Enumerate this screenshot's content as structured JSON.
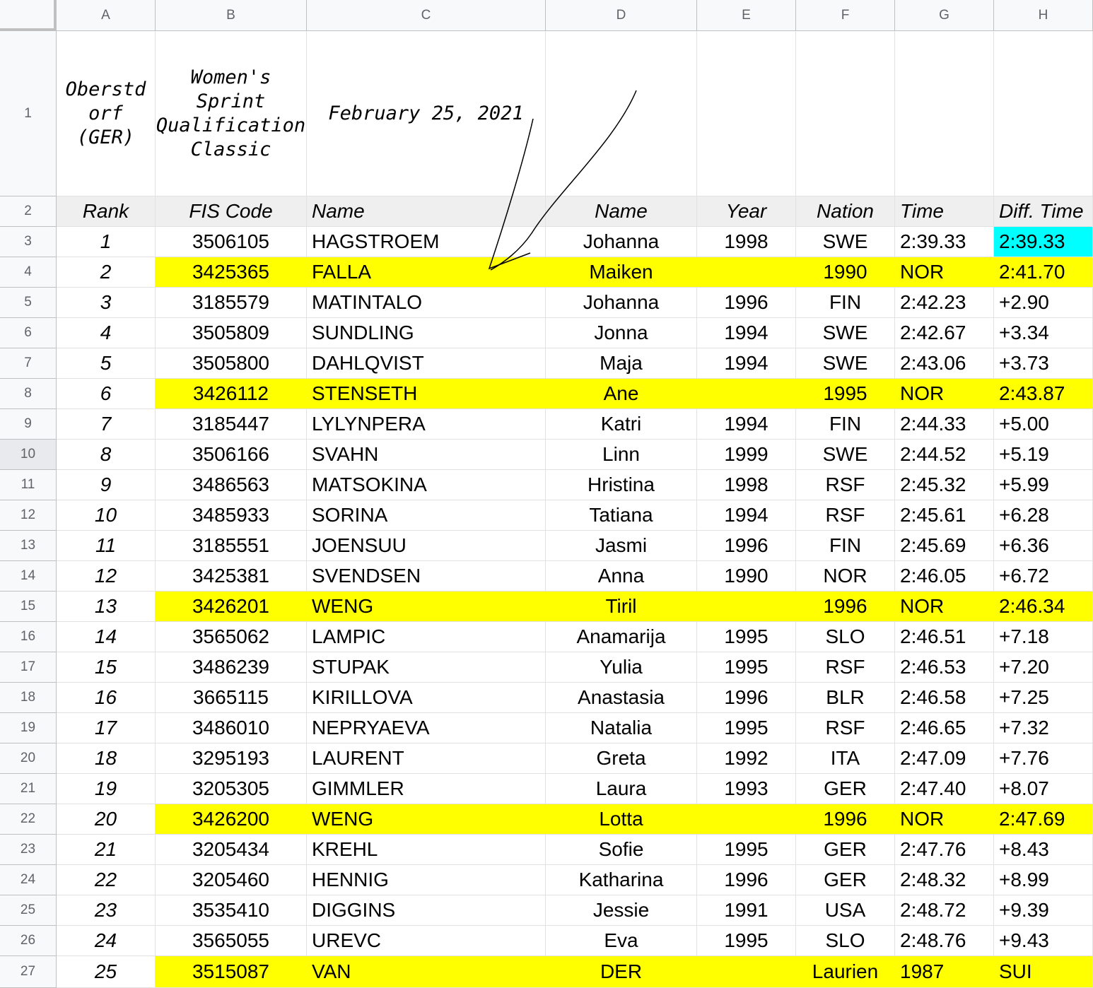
{
  "columns": [
    "A",
    "B",
    "C",
    "D",
    "E",
    "F",
    "G",
    "H"
  ],
  "title_row": {
    "location": "Oberstd orf (GER)",
    "event": "Women's Sprint Qualification Classic",
    "date": "February 25, 2021"
  },
  "header_row": [
    "Rank",
    "FIS Code",
    "Name",
    "Name",
    "Year",
    "Nation",
    "Time",
    "Diff. Time"
  ],
  "rows": [
    {
      "n": "3",
      "cells": [
        "1",
        "3506105",
        "HAGSTROEM",
        "Johanna",
        "1998",
        "SWE",
        "2:39.33",
        "2:39.33"
      ],
      "hl": false
    },
    {
      "n": "4",
      "cells": [
        "2",
        "3425365",
        "FALLA",
        "Maiken",
        "",
        "1990",
        "NOR",
        "2:41.70"
      ],
      "hl": true
    },
    {
      "n": "5",
      "cells": [
        "3",
        "3185579",
        "MATINTALO",
        "Johanna",
        "1996",
        "FIN",
        "2:42.23",
        "+2.90"
      ],
      "hl": false
    },
    {
      "n": "6",
      "cells": [
        "4",
        "3505809",
        "SUNDLING",
        "Jonna",
        "1994",
        "SWE",
        "2:42.67",
        "+3.34"
      ],
      "hl": false
    },
    {
      "n": "7",
      "cells": [
        "5",
        "3505800",
        "DAHLQVIST",
        "Maja",
        "1994",
        "SWE",
        "2:43.06",
        "+3.73"
      ],
      "hl": false
    },
    {
      "n": "8",
      "cells": [
        "6",
        "3426112",
        "STENSETH",
        "Ane",
        "",
        "1995",
        "NOR",
        "2:43.87"
      ],
      "hl": true
    },
    {
      "n": "9",
      "cells": [
        "7",
        "3185447",
        "LYLYNPERA",
        "Katri",
        "1994",
        "FIN",
        "2:44.33",
        "+5.00"
      ],
      "hl": false
    },
    {
      "n": "10",
      "cells": [
        "8",
        "3506166",
        "SVAHN",
        "Linn",
        "1999",
        "SWE",
        "2:44.52",
        "+5.19"
      ],
      "hl": false
    },
    {
      "n": "11",
      "cells": [
        "9",
        "3486563",
        "MATSOKINA",
        "Hristina",
        "1998",
        "RSF",
        "2:45.32",
        "+5.99"
      ],
      "hl": false
    },
    {
      "n": "12",
      "cells": [
        "10",
        "3485933",
        "SORINA",
        "Tatiana",
        "1994",
        "RSF",
        "2:45.61",
        "+6.28"
      ],
      "hl": false
    },
    {
      "n": "13",
      "cells": [
        "11",
        "3185551",
        "JOENSUU",
        "Jasmi",
        "1996",
        "FIN",
        "2:45.69",
        "+6.36"
      ],
      "hl": false
    },
    {
      "n": "14",
      "cells": [
        "12",
        "3425381",
        "SVENDSEN",
        "Anna",
        "1990",
        "NOR",
        "2:46.05",
        "+6.72"
      ],
      "hl": false
    },
    {
      "n": "15",
      "cells": [
        "13",
        "3426201",
        "WENG",
        "Tiril",
        "",
        "1996",
        "NOR",
        "2:46.34"
      ],
      "hl": true
    },
    {
      "n": "16",
      "cells": [
        "14",
        "3565062",
        "LAMPIC",
        "Anamarija",
        "1995",
        "SLO",
        "2:46.51",
        "+7.18"
      ],
      "hl": false
    },
    {
      "n": "17",
      "cells": [
        "15",
        "3486239",
        "STUPAK",
        "Yulia",
        "1995",
        "RSF",
        "2:46.53",
        "+7.20"
      ],
      "hl": false
    },
    {
      "n": "18",
      "cells": [
        "16",
        "3665115",
        "KIRILLOVA",
        "Anastasia",
        "1996",
        "BLR",
        "2:46.58",
        "+7.25"
      ],
      "hl": false
    },
    {
      "n": "19",
      "cells": [
        "17",
        "3486010",
        "NEPRYAEVA",
        "Natalia",
        "1995",
        "RSF",
        "2:46.65",
        "+7.32"
      ],
      "hl": false
    },
    {
      "n": "20",
      "cells": [
        "18",
        "3295193",
        "LAURENT",
        "Greta",
        "1992",
        "ITA",
        "2:47.09",
        "+7.76"
      ],
      "hl": false
    },
    {
      "n": "21",
      "cells": [
        "19",
        "3205305",
        "GIMMLER",
        "Laura",
        "1993",
        "GER",
        "2:47.40",
        "+8.07"
      ],
      "hl": false
    },
    {
      "n": "22",
      "cells": [
        "20",
        "3426200",
        "WENG",
        "Lotta",
        "",
        "1996",
        "NOR",
        "2:47.69"
      ],
      "hl": true
    },
    {
      "n": "23",
      "cells": [
        "21",
        "3205434",
        "KREHL",
        "Sofie",
        "1995",
        "GER",
        "2:47.76",
        "+8.43"
      ],
      "hl": false
    },
    {
      "n": "24",
      "cells": [
        "22",
        "3205460",
        "HENNIG",
        "Katharina",
        "1996",
        "GER",
        "2:48.32",
        "+8.99"
      ],
      "hl": false
    },
    {
      "n": "25",
      "cells": [
        "23",
        "3535410",
        "DIGGINS",
        "Jessie",
        "1991",
        "USA",
        "2:48.72",
        "+9.39"
      ],
      "hl": false
    },
    {
      "n": "26",
      "cells": [
        "24",
        "3565055",
        "UREVC",
        "Eva",
        "1995",
        "SLO",
        "2:48.76",
        "+9.43"
      ],
      "hl": false
    },
    {
      "n": "27",
      "cells": [
        "25",
        "3515087",
        "VAN",
        "DER",
        "",
        "Laurien",
        "1987",
        "SUI"
      ],
      "hl": true
    }
  ],
  "colors": {
    "highlight": "#ffff00",
    "selected": "#00ffff",
    "header_bg": "#f8f9fa"
  }
}
